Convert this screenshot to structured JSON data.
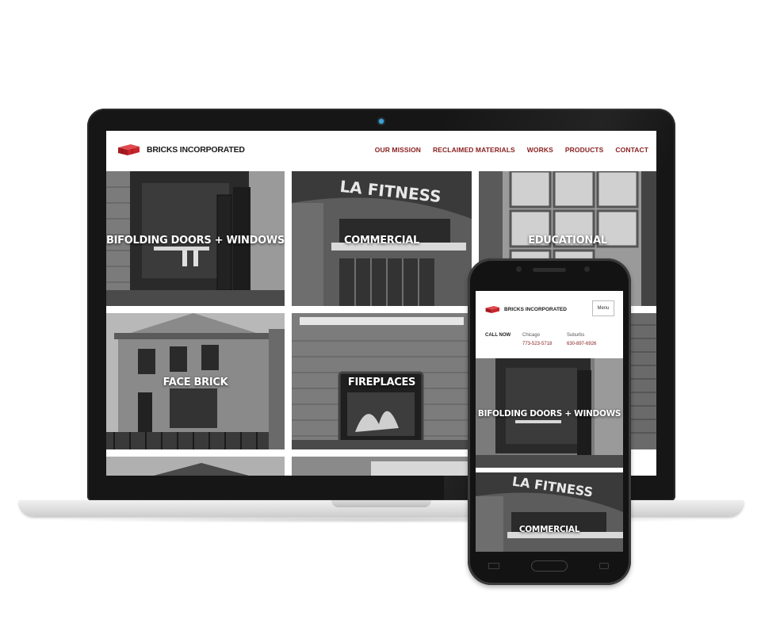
{
  "brand": {
    "name": "BRICKS INCORPORATED",
    "accent": "#8a2020",
    "logo_red": "#c8242b"
  },
  "nav": {
    "items": [
      "OUR MISSION",
      "RECLAIMED MATERIALS",
      "WORKS",
      "PRODUCTS",
      "CONTACT"
    ]
  },
  "desktop_tiles": [
    {
      "label": "BIFOLDING DOORS + WINDOWS"
    },
    {
      "label": "COMMERCIAL"
    },
    {
      "label": "EDUCATIONAL"
    },
    {
      "label": "FACE BRICK"
    },
    {
      "label": "FIREPLACES"
    }
  ],
  "building_sign": "LA FITNESS",
  "mobile": {
    "menu_label": "Menu",
    "call_now": "CALL NOW",
    "contacts": [
      {
        "city": "Chicago",
        "phone": "773-523-5718"
      },
      {
        "city": "Suburbs",
        "phone": "630-897-6926"
      }
    ],
    "tiles": [
      {
        "label": "BIFOLDING DOORS + WINDOWS"
      },
      {
        "label": "COMMERCIAL"
      }
    ]
  }
}
